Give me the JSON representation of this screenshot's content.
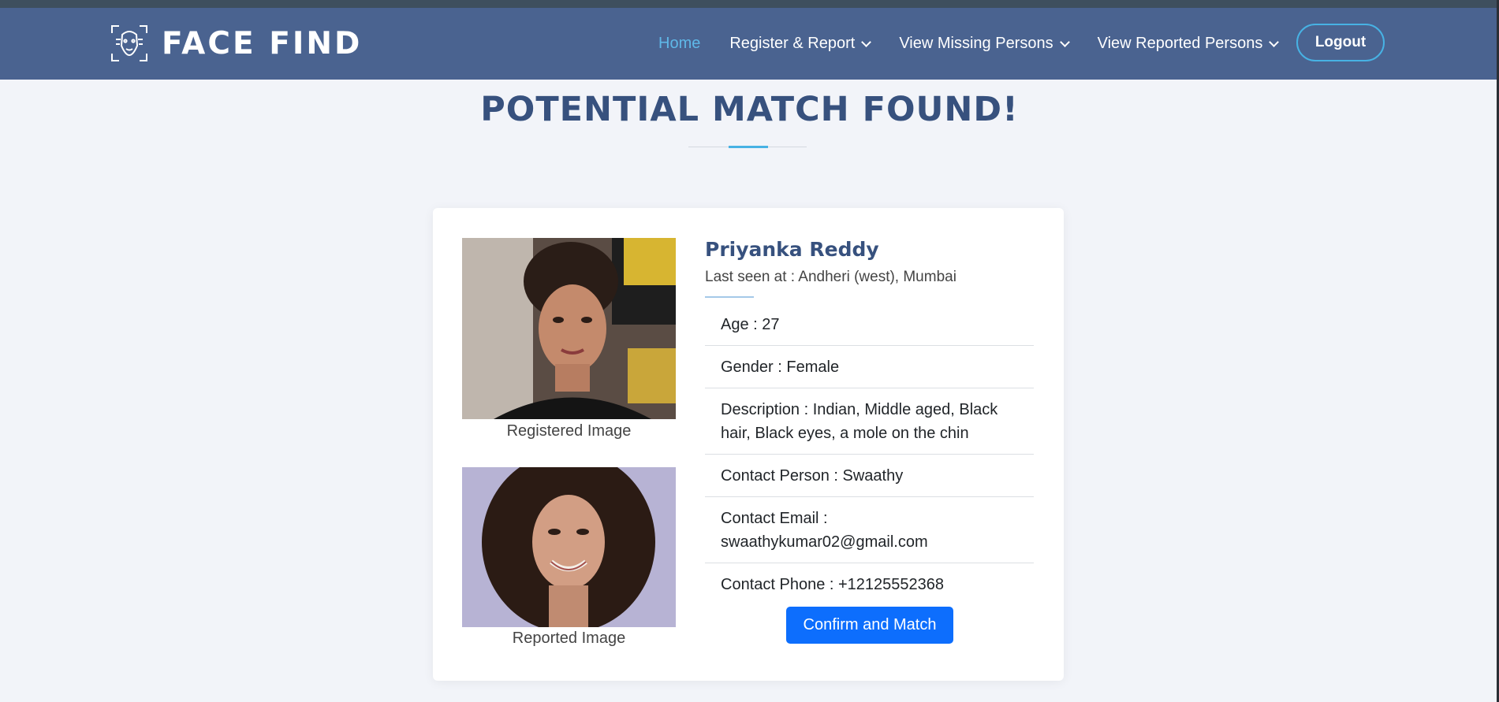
{
  "brand": {
    "name": "FACE FIND",
    "logo_icon": "face-scan-icon"
  },
  "nav": {
    "items": [
      {
        "label": "Home",
        "active": true
      },
      {
        "label": "Register & Report",
        "has_dropdown": true
      },
      {
        "label": "View Missing Persons",
        "has_dropdown": true
      },
      {
        "label": "View Reported Persons",
        "has_dropdown": true
      }
    ],
    "logout_label": "Logout"
  },
  "page": {
    "title": "POTENTIAL MATCH FOUND!"
  },
  "match": {
    "registered_caption": "Registered Image",
    "reported_caption": "Reported Image",
    "name": "Priyanka Reddy",
    "last_seen": "Last seen at : Andheri (west), Mumbai",
    "details": [
      "Age : 27",
      "Gender : Female",
      "Description : Indian, Middle aged, Black hair, Black eyes, a mole on the chin",
      "Contact Person : Swaathy",
      "Contact Email : swaathykumar02@gmail.com",
      "Contact Phone : +12125552368"
    ],
    "confirm_label": "Confirm and Match"
  },
  "colors": {
    "navbar": "#4a6390",
    "accent": "#47b2e4",
    "heading": "#37517e",
    "primary_button": "#0d6efd",
    "background": "#f2f4f9"
  }
}
